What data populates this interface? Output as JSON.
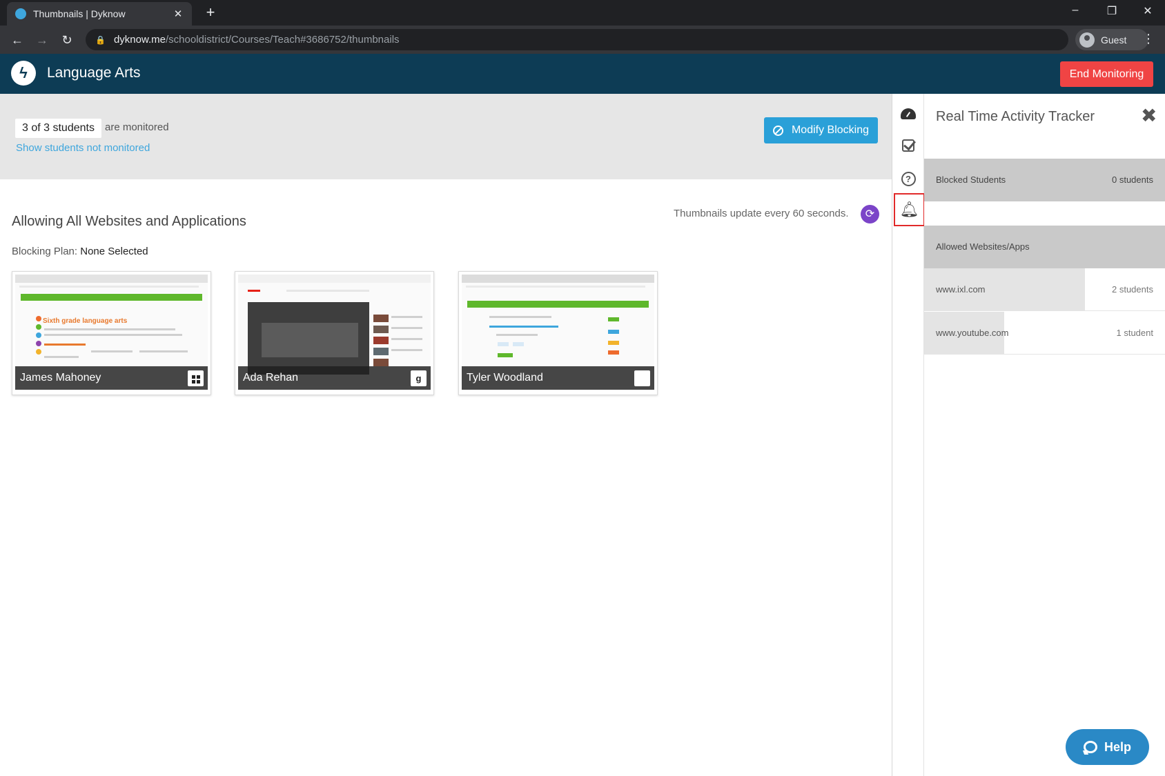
{
  "browser": {
    "tab_title": "Thumbnails | Dyknow",
    "tab_close": "✕",
    "new_tab": "+",
    "url_host": "dyknow.me",
    "url_path": "/schooldistrict/Courses/Teach#3686752/thumbnails",
    "profile_label": "Guest",
    "icons": [
      "back-icon",
      "forward-icon",
      "reload-icon",
      "lock-icon",
      "minimize-icon",
      "restore-icon",
      "close-icon",
      "menu-icon"
    ]
  },
  "header": {
    "course_title": "Language Arts",
    "end_button": "End Monitoring",
    "accent": "#0d3c55",
    "end_color": "#f04444"
  },
  "monitor": {
    "count": "3 of 3 students",
    "suffix": "are monitored",
    "not_monitored_link": "Show students not monitored",
    "modify_button": "Modify Blocking"
  },
  "content": {
    "allow_title": "Allowing All Websites and Applications",
    "blocking_plan_label": "Blocking Plan:",
    "blocking_plan_value": "None Selected",
    "update_text": "Thumbnails update every 60 seconds."
  },
  "students": [
    {
      "name": "James Mahoney",
      "os": "windows",
      "screen": "ixl-language-arts",
      "screen_heading": "Sixth grade language arts"
    },
    {
      "name": "Ada Rehan",
      "os": "chromebook",
      "os_glyph": "g",
      "screen": "youtube"
    },
    {
      "name": "Tyler Woodland",
      "os": "mac",
      "os_glyph": "",
      "screen": "ixl"
    }
  ],
  "tracker": {
    "title": "Real Time Activity Tracker",
    "close": "✖",
    "blocked_label": "Blocked Students",
    "blocked_count": "0 students",
    "allowed_label": "Allowed Websites/Apps",
    "sites": [
      {
        "name": "www.ixl.com",
        "count": "2 students",
        "fraction": 0.667
      },
      {
        "name": "www.youtube.com",
        "count": "1 student",
        "fraction": 0.333
      }
    ]
  },
  "rail": [
    "dashboard-icon",
    "checkbox-icon",
    "help-icon",
    "bell-icon"
  ],
  "help_button": "Help"
}
